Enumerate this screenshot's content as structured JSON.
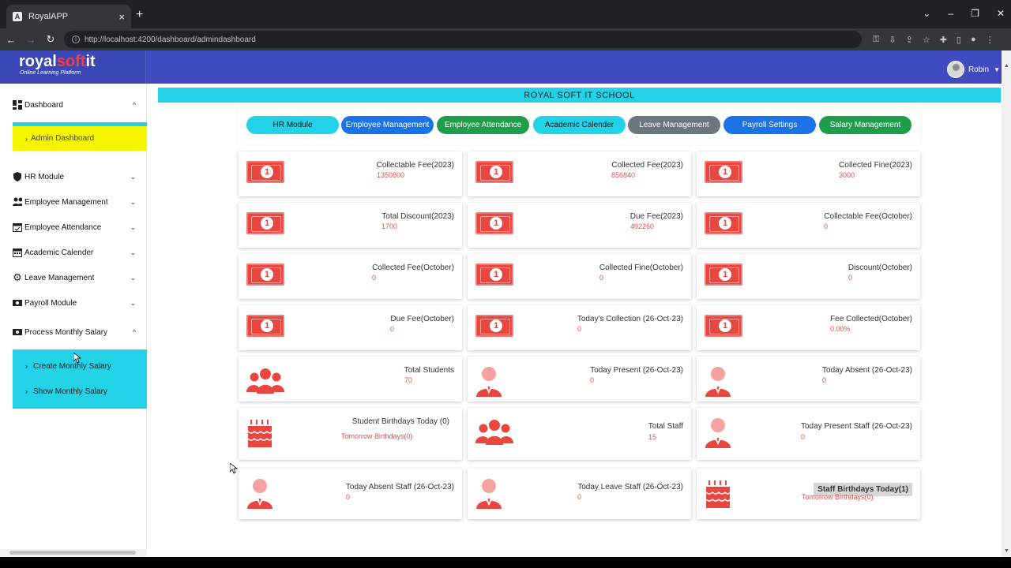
{
  "browser": {
    "tab_title": "RoyalAPP",
    "tab_favicon": "A",
    "tab_close": "×",
    "new_tab": "+",
    "url": "http://localhost:4200/dashboard/admindashboard",
    "win_min": "–",
    "win_max": "❐",
    "win_close": "✕",
    "win_dropdown": "⌄"
  },
  "app": {
    "logo_main_1": "royal",
    "logo_main_2": "soft",
    "logo_main_3": "it",
    "logo_tagline": "Online Learning Platform",
    "user_name": "Robin",
    "school_name": "ROYAL SOFT IT SCHOOL"
  },
  "sidebar": {
    "items": [
      {
        "label": "Dashboard",
        "icon": "dashboard-icon",
        "chevron": "^"
      },
      {
        "label": "HR Module",
        "icon": "shield-icon",
        "chevron": "⌄"
      },
      {
        "label": "Employee Management",
        "icon": "users-icon",
        "chevron": "⌄"
      },
      {
        "label": "Employee Attendance",
        "icon": "calendar-check-icon",
        "chevron": "⌄"
      },
      {
        "label": "Academic Calender",
        "icon": "calendar-icon",
        "chevron": "⌄"
      },
      {
        "label": "Leave Management",
        "icon": "gear-icon",
        "chevron": "⌄"
      },
      {
        "label": "Payroll Module",
        "icon": "money-icon",
        "chevron": "⌄"
      },
      {
        "label": "Process Monthly Salary",
        "icon": "money-icon",
        "chevron": "^"
      }
    ],
    "admin_dashboard": "Admin Dashboard",
    "create_salary": "Create Monthly Salary",
    "show_salary": "Show Monthly Salary"
  },
  "nav_pills": [
    {
      "label": "HR Module",
      "color": "#22d3e8"
    },
    {
      "label": "Employee Management",
      "color": "#1a73e8"
    },
    {
      "label": "Employee Attendance",
      "color": "#1e9e4a"
    },
    {
      "label": "Academic Calender",
      "color": "#22d3e8"
    },
    {
      "label": "Leave Management",
      "color": "#6c757d"
    },
    {
      "label": "Payroll Settings",
      "color": "#1a73e8"
    },
    {
      "label": "Salary Management",
      "color": "#1e9e4a"
    }
  ],
  "cards": [
    {
      "title": "Collectable Fee(2023)",
      "value": "1350800",
      "icon": "money-bill-icon"
    },
    {
      "title": "Collected Fee(2023)",
      "value": "856840",
      "icon": "money-bill-icon"
    },
    {
      "title": "Collected Fine(2023)",
      "value": "3000",
      "icon": "money-bill-icon"
    },
    {
      "title": "Total Discount(2023)",
      "value": "1700",
      "icon": "money-bill-icon"
    },
    {
      "title": "Due Fee(2023)",
      "value": "492260",
      "icon": "money-bill-icon"
    },
    {
      "title": "Collectable Fee(October)",
      "value": "0",
      "icon": "money-bill-icon"
    },
    {
      "title": "Collected Fee(October)",
      "value": "0",
      "icon": "money-bill-icon"
    },
    {
      "title": "Collected Fine(October)",
      "value": "0",
      "icon": "money-bill-icon"
    },
    {
      "title": "Discount(October)",
      "value": "0",
      "icon": "money-bill-icon"
    },
    {
      "title": "Due Fee(October)",
      "value": "0",
      "icon": "money-bill-icon"
    },
    {
      "title": "Today's Collection (26-Oct-23)",
      "value": "0",
      "icon": "money-bill-icon"
    },
    {
      "title": "Fee Collected(October)",
      "value": "0.00%",
      "icon": "money-bill-icon"
    },
    {
      "title": "Total Students",
      "value": "70",
      "icon": "users-group-icon"
    },
    {
      "title": "Today Present (26-Oct-23)",
      "value": "0",
      "icon": "person-icon"
    },
    {
      "title": "Today Absent (26-Oct-23)",
      "value": "0",
      "icon": "person-icon"
    },
    {
      "title": "Student Birthdays Today (0)",
      "value": "Tomorrow Birthdays(0)",
      "icon": "birthday-cake-icon"
    },
    {
      "title": "Total Staff",
      "value": "15",
      "icon": "users-group-icon"
    },
    {
      "title": "Today Present Staff (26-Oct-23)",
      "value": "0",
      "icon": "person-icon"
    },
    {
      "title": "Today Absent Staff (26-Oct-23)",
      "value": "0",
      "icon": "person-icon"
    },
    {
      "title": "Today Leave Staff (26-Oct-23)",
      "value": "0",
      "icon": "person-icon"
    },
    {
      "title": "Staff Birthdays Today(1)",
      "value": "Tomorrow Birthdays(0)",
      "icon": "birthday-cake-icon"
    }
  ],
  "colors": {
    "header": "#3f4bbf",
    "accent_cyan": "#22d3e8",
    "accent_yellow": "#f5f500",
    "icon_red": "#e8463f",
    "value_red": "#e05050"
  }
}
